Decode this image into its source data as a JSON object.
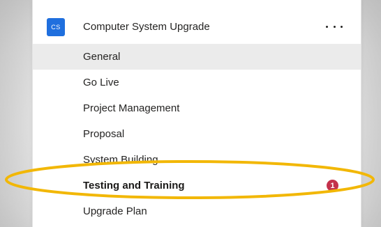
{
  "team": {
    "avatar_text": "CS",
    "name": "Computer System Upgrade",
    "more_icon": "more-horizontal-icon",
    "avatar_color": "#1f6fde"
  },
  "channels": [
    {
      "label": "General",
      "selected": true
    },
    {
      "label": "Go Live"
    },
    {
      "label": "Project Management"
    },
    {
      "label": "Proposal"
    },
    {
      "label": "System Building"
    },
    {
      "label": "Testing and Training",
      "bold": true,
      "mention_count": "1"
    },
    {
      "label": "Upgrade Plan"
    }
  ],
  "colors": {
    "highlight_ring": "#f2b705",
    "mention_badge": "#c4314b",
    "selected_row": "#ebebeb"
  }
}
